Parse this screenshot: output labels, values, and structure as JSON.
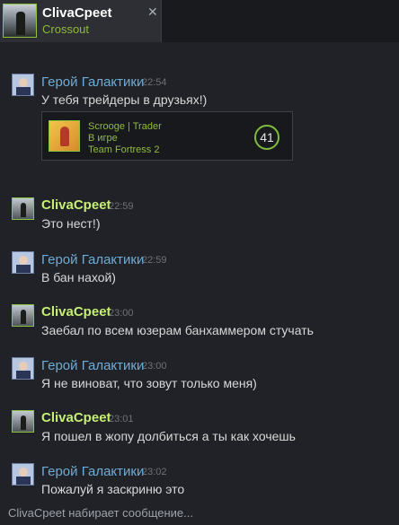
{
  "tab": {
    "name": "ClivaCpeet",
    "game": "Crossout",
    "close_icon": "close-icon"
  },
  "messages": [
    {
      "sender": "Герой Галактики",
      "time": "22:54",
      "text": "У тебя трейдеры в друзьях!)"
    },
    {
      "sender": "ClivaCpeet",
      "time": "22:59",
      "text": "Это нест!)"
    },
    {
      "sender": "Герой Галактики",
      "time": "22:59",
      "text": "В бан нахой)"
    },
    {
      "sender": "ClivaCpeet",
      "time": "23:00",
      "text": "Заебал по всем юзерам банхаммером стучать"
    },
    {
      "sender": "Герой Галактики",
      "time": "23:00",
      "text": "Я не виноват, что зовут только меня)"
    },
    {
      "sender": "ClivaCpeet",
      "time": "23:01",
      "text": "Я пошел в жопу долбиться а ты как хочешь"
    },
    {
      "sender": "Герой Галактики",
      "time": "23:02",
      "text": "Пожалуй я заскриню это"
    }
  ],
  "friend_card": {
    "name": "Scrooge | Trader",
    "status": "В игре",
    "game": "Team Fortress 2",
    "level": "41"
  },
  "typing": {
    "user": "ClivaCpeet",
    "text": "набирает сообщение..."
  },
  "colors": {
    "background": "#202227",
    "hero_name": "#6dacd6",
    "clv_name": "#c6ef74",
    "in_game": "#90ba3c"
  }
}
